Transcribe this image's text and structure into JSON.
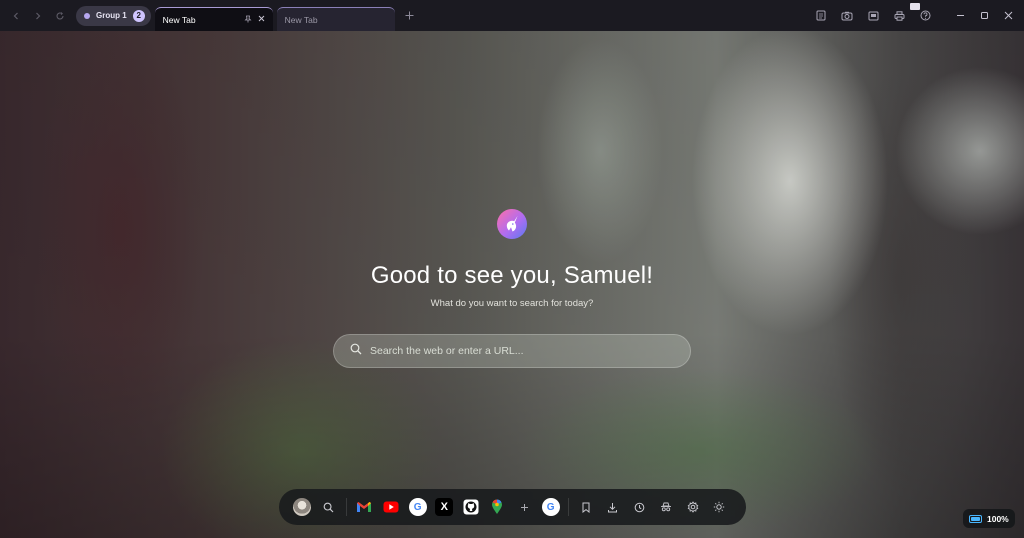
{
  "browser": {
    "group": {
      "label": "Group 1",
      "count": "2",
      "dot_color": "#b7a8f0"
    },
    "tabs": [
      {
        "title": "New Tab",
        "active": true
      },
      {
        "title": "New Tab",
        "active": false
      }
    ],
    "accent": "#a99bd6"
  },
  "page": {
    "greeting": "Good to see you, Samuel!",
    "subtitle": "What do you want to search for today?",
    "search": {
      "placeholder": "Search the web or enter a URL..."
    }
  },
  "dock": {
    "items": [
      "avatar",
      "search-icon",
      "gmail-icon",
      "youtube-icon",
      "google-icon",
      "x-icon",
      "github-icon",
      "maps-icon",
      "add-icon",
      "google-icon",
      "bookmark-icon",
      "download-icon",
      "history-icon",
      "incognito-icon",
      "settings-icon",
      "brightness-icon"
    ]
  },
  "status": {
    "battery": "100%",
    "battery_color": "#49b6ff"
  }
}
